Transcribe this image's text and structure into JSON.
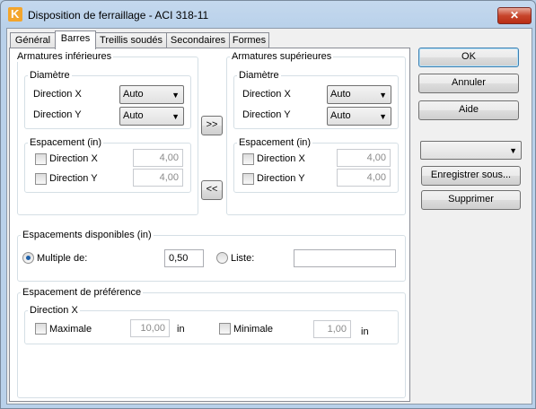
{
  "window": {
    "title": "Disposition de ferraillage - ACI 318-11",
    "close_glyph": "✕"
  },
  "tabs": [
    {
      "label": "Général"
    },
    {
      "label": "Barres",
      "active": true
    },
    {
      "label": "Treillis soudés"
    },
    {
      "label": "Secondaires"
    },
    {
      "label": "Formes"
    }
  ],
  "inferieures": {
    "title": "Armatures inférieures",
    "diametre": {
      "title": "Diamètre",
      "dir_x_label": "Direction X",
      "dir_x_value": "Auto",
      "dir_y_label": "Direction Y",
      "dir_y_value": "Auto"
    },
    "espacement": {
      "title": "Espacement (in)",
      "dir_x_label": "Direction X",
      "dir_x_value": "4,00",
      "dir_y_label": "Direction Y",
      "dir_y_value": "4,00"
    }
  },
  "superieures": {
    "title": "Armatures supérieures",
    "diametre": {
      "title": "Diamètre",
      "dir_x_label": "Direction X",
      "dir_x_value": "Auto",
      "dir_y_label": "Direction Y",
      "dir_y_value": "Auto"
    },
    "espacement": {
      "title": "Espacement (in)",
      "dir_x_label": "Direction X",
      "dir_x_value": "4,00",
      "dir_y_label": "Direction Y",
      "dir_y_value": "4,00"
    }
  },
  "copy_buttons": {
    "to_right": ">>",
    "to_left": "<<"
  },
  "espacements_disponibles": {
    "title": "Espacements disponibles (in)",
    "multiple_label": "Multiple de:",
    "multiple_value": "0,50",
    "liste_label": "Liste:",
    "liste_value": ""
  },
  "espacement_preference": {
    "title": "Espacement de préférence",
    "direction_title": "Direction X",
    "maximale_label": "Maximale",
    "maximale_value": "10,00",
    "maximale_unit": "in",
    "minimale_label": "Minimale",
    "minimale_value": "1,00",
    "minimale_unit": "in"
  },
  "side": {
    "ok": "OK",
    "annuler": "Annuler",
    "aide": "Aide",
    "preset_value": "",
    "enregistrer": "Enregistrer sous...",
    "supprimer": "Supprimer"
  },
  "icons": {
    "dropdown_arrow": "▼"
  }
}
